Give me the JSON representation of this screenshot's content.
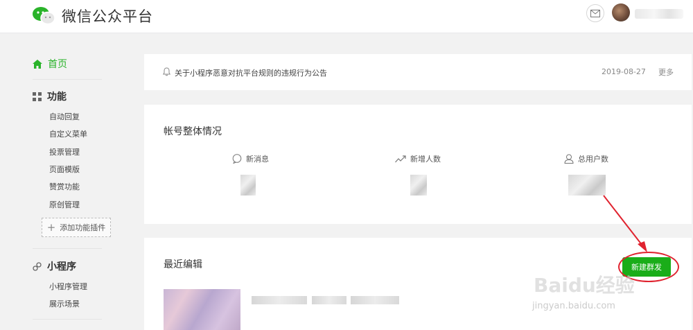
{
  "header": {
    "brand": "微信公众平台"
  },
  "sidebar": {
    "home": "首页",
    "sections": [
      {
        "title": "功能",
        "items": [
          "自动回复",
          "自定义菜单",
          "投票管理",
          "页面模版",
          "赞赏功能",
          "原创管理"
        ]
      },
      {
        "title": "小程序",
        "items": [
          "小程序管理",
          "展示场景"
        ]
      }
    ],
    "add_plugin": "添加功能插件"
  },
  "notice": {
    "text": "关于小程序恶意对抗平台规则的违规行为公告",
    "date": "2019-08-27",
    "more": "更多"
  },
  "overview": {
    "title": "帐号整体情况",
    "stats": [
      {
        "label": "新消息",
        "icon": "message-icon"
      },
      {
        "label": "新增人数",
        "icon": "trend-up-icon"
      },
      {
        "label": "总用户数",
        "icon": "user-icon"
      }
    ]
  },
  "recent": {
    "title": "最近编辑",
    "new_button": "新建群发"
  },
  "watermark": {
    "text": "Baidu经验",
    "sub": "jingyan.baidu.com"
  },
  "colors": {
    "brand_green": "#1aad19",
    "home_green": "#2ab32a",
    "annotation_red": "#e0232f"
  }
}
